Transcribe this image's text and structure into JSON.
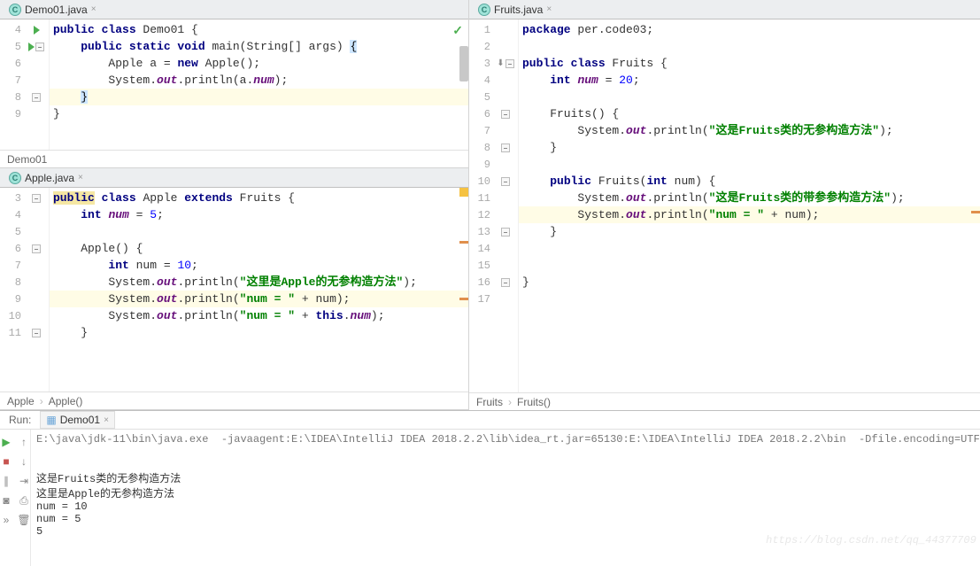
{
  "tabs": {
    "demo": "Demo01.java",
    "apple": "Apple.java",
    "fruits": "Fruits.java"
  },
  "demo": {
    "start": 4,
    "lines": [
      {
        "n": 4,
        "html": "<span class='kw'>public class</span> Demo01 {",
        "run": true
      },
      {
        "n": 5,
        "html": "    <span class='kw'>public static void</span> main(String[] args) <span class='cur-br'>{</span>",
        "run": true,
        "fold": true
      },
      {
        "n": 6,
        "html": "        Apple a = <span class='kw'>new</span> Apple();"
      },
      {
        "n": 7,
        "html": "        System.<span class='fld'>out</span>.println(a.<span class='fld'>num</span>);"
      },
      {
        "n": 8,
        "html": "    <span class='cur-br'>}</span>",
        "hl": true,
        "fold": true
      },
      {
        "n": 9,
        "html": "}"
      }
    ],
    "breadcrumb": [
      "Demo01"
    ]
  },
  "apple": {
    "lines": [
      {
        "n": 3,
        "html": "<span style='background:#f5e7a3'><span class='kw'>public</span></span> <span class='kw'>class</span> Apple <span class='kw'>extends</span> Fruits {",
        "fold": true
      },
      {
        "n": 4,
        "html": "    <span class='kw'>int</span> <span class='fld'>num</span> = <span class='num-lit'>5</span>;"
      },
      {
        "n": 5,
        "html": ""
      },
      {
        "n": 6,
        "html": "    Apple() {",
        "fold": true
      },
      {
        "n": 7,
        "html": "        <span class='kw'>int</span> num = <span class='num-lit'>10</span>;"
      },
      {
        "n": 8,
        "html": "        System.<span class='fld'>out</span>.println(<span class='str'>\"这里是Apple的无参构造方法\"</span>);"
      },
      {
        "n": 9,
        "html": "        System.<span class='fld'>out</span>.println(<span class='str'>\"num = \"</span> + num);",
        "hl": true
      },
      {
        "n": 10,
        "html": "        System.<span class='fld'>out</span>.println(<span class='str'>\"num = \"</span> + <span class='kw'>this</span>.<span class='fld'>num</span>);"
      },
      {
        "n": 11,
        "html": "    }",
        "fold": true
      }
    ],
    "breadcrumb": [
      "Apple",
      "Apple()"
    ]
  },
  "fruits": {
    "lines": [
      {
        "n": 1,
        "html": "<span class='kw'>package</span> per.code03;"
      },
      {
        "n": 2,
        "html": ""
      },
      {
        "n": 3,
        "html": "<span class='kw'>public class</span> Fruits {",
        "arrow": true,
        "fold": true
      },
      {
        "n": 4,
        "html": "    <span class='kw'>int</span> <span class='fld'>num</span> = <span class='num-lit'>20</span>;"
      },
      {
        "n": 5,
        "html": ""
      },
      {
        "n": 6,
        "html": "    Fruits() {",
        "fold": true
      },
      {
        "n": 7,
        "html": "        System.<span class='fld'>out</span>.println(<span class='str'>\"这是Fruits类的无参构造方法\"</span>);"
      },
      {
        "n": 8,
        "html": "    }",
        "fold": true
      },
      {
        "n": 9,
        "html": ""
      },
      {
        "n": 10,
        "html": "    <span class='kw'>public</span> Fruits(<span class='kw'>int</span> num) {",
        "fold": true
      },
      {
        "n": 11,
        "html": "        System.<span class='fld'>out</span>.println(<span class='str'>\"这是Fruits类的带参参构造方法\"</span>);"
      },
      {
        "n": 12,
        "html": "        System.<span class='fld'>out</span>.println(<span class='str'>\"num = \"</span> + num);",
        "hl": true
      },
      {
        "n": 13,
        "html": "    }",
        "fold": true
      },
      {
        "n": 14,
        "html": ""
      },
      {
        "n": 15,
        "html": ""
      },
      {
        "n": 16,
        "html": "}",
        "fold": true
      },
      {
        "n": 17,
        "html": ""
      }
    ],
    "breadcrumb": [
      "Fruits",
      "Fruits()"
    ]
  },
  "run": {
    "label": "Run:",
    "tab": "Demo01",
    "cmd": "E:\\java\\jdk-11\\bin\\java.exe  -javaagent:E:\\IDEA\\IntelliJ IDEA 2018.2.2\\lib\\idea_rt.jar=65130:E:\\IDEA\\IntelliJ IDEA 2018.2.2\\bin  -Dfile.encoding=UTF",
    "out": [
      "这是Fruits类的无参构造方法",
      "这里是Apple的无参构造方法",
      "num = 10",
      "num = 5",
      "5"
    ]
  },
  "watermark": "https://blog.csdn.net/qq_44377709"
}
